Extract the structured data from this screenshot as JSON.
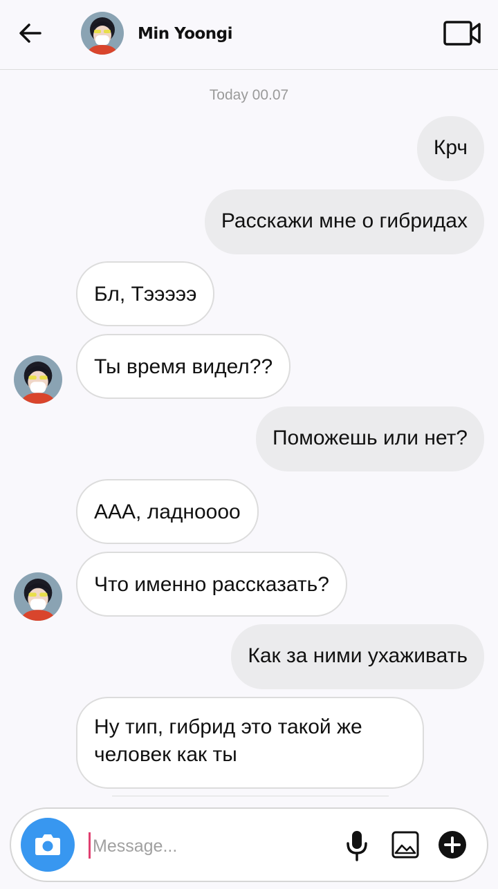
{
  "header": {
    "contact_name": "Min Yoongi",
    "icons": {
      "back": "back-arrow-icon",
      "video": "video-camera-icon"
    }
  },
  "conversation": {
    "timestamp": "Today 00.07",
    "messages": [
      {
        "direction": "sent",
        "text": "Крч"
      },
      {
        "direction": "sent",
        "text": "Расскажи мне о гибридах"
      },
      {
        "direction": "received",
        "text": "Бл, Тэээээ"
      },
      {
        "direction": "received",
        "text": "Ты время видел??",
        "avatar": true
      },
      {
        "direction": "sent",
        "text": "Поможешь или нет?"
      },
      {
        "direction": "received",
        "text": "ААА, ладноооо"
      },
      {
        "direction": "received",
        "text": "Что именно рассказать?",
        "avatar": true
      },
      {
        "direction": "sent",
        "text": "Как за ними ухаживать"
      },
      {
        "direction": "received",
        "text": "Ну тип, гибрид это такой же человек как ты"
      }
    ]
  },
  "composer": {
    "placeholder": "Message...",
    "value": "",
    "icons": {
      "camera": "camera-icon",
      "mic": "microphone-icon",
      "gallery": "gallery-icon",
      "add": "plus-circle-icon"
    }
  },
  "colors": {
    "accent": "#3897f0",
    "sent_bubble": "#ebebed",
    "received_bubble": "#ffffff",
    "background": "#f9f8fc"
  }
}
